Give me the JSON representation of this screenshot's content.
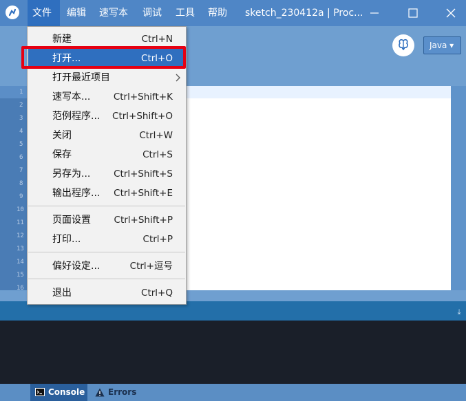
{
  "menubar": {
    "items": [
      "文件",
      "编辑",
      "速写本",
      "调试",
      "工具",
      "帮助"
    ],
    "window_title": "sketch_230412a | Proc..."
  },
  "toolbar": {
    "mode_icon": "butterfly-icon",
    "mode_select": "Java ▾"
  },
  "editor": {
    "line_numbers": [
      "1",
      "2",
      "3",
      "4",
      "5",
      "6",
      "7",
      "8",
      "9",
      "10",
      "11",
      "12",
      "13",
      "14",
      "15",
      "16"
    ]
  },
  "file_menu": {
    "groups": [
      [
        {
          "label": "新建",
          "shortcut": "Ctrl+N"
        },
        {
          "label": "打开...",
          "shortcut": "Ctrl+O",
          "highlighted": true
        },
        {
          "label": "打开最近项目",
          "shortcut": "",
          "submenu": true
        },
        {
          "label": "速写本...",
          "shortcut": "Ctrl+Shift+K"
        },
        {
          "label": "范例程序...",
          "shortcut": "Ctrl+Shift+O"
        },
        {
          "label": "关闭",
          "shortcut": "Ctrl+W"
        },
        {
          "label": "保存",
          "shortcut": "Ctrl+S"
        },
        {
          "label": "另存为...",
          "shortcut": "Ctrl+Shift+S"
        },
        {
          "label": "输出程序...",
          "shortcut": "Ctrl+Shift+E"
        }
      ],
      [
        {
          "label": "页面设置",
          "shortcut": "Ctrl+Shift+P"
        },
        {
          "label": "打印...",
          "shortcut": "Ctrl+P"
        }
      ],
      [
        {
          "label": "偏好设定...",
          "shortcut": "Ctrl+逗号"
        }
      ],
      [
        {
          "label": "退出",
          "shortcut": "Ctrl+Q"
        }
      ]
    ]
  },
  "footer": {
    "console_label": "Console",
    "errors_label": "Errors"
  },
  "colors": {
    "accent": "#2f6fbf",
    "annotation": "#e60012"
  }
}
